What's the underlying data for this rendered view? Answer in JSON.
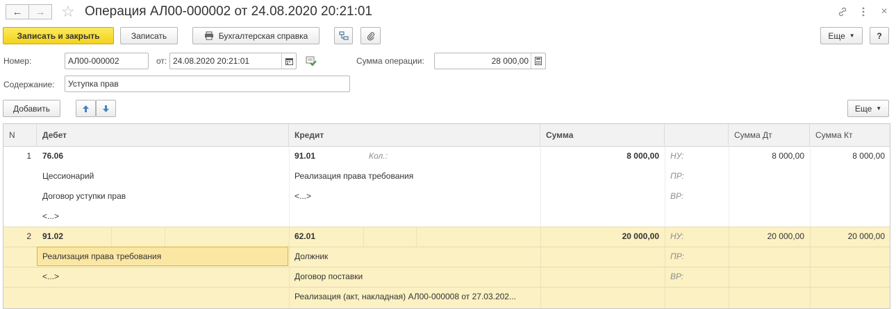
{
  "window": {
    "title": "Операция АЛ00-000002 от 24.08.2020 20:21:01"
  },
  "toolbar": {
    "save_close_label": "Записать и закрыть",
    "save_label": "Записать",
    "report_label": "Бухгалтерская справка",
    "more_label": "Еще",
    "help_label": "?"
  },
  "form": {
    "number_label": "Номер:",
    "number_value": "АЛ00-000002",
    "date_label": "от:",
    "date_value": "24.08.2020 20:21:01",
    "sum_label": "Сумма операции:",
    "sum_value": "28 000,00",
    "content_label": "Содержание:",
    "content_value": "Уступка прав"
  },
  "table_toolbar": {
    "add_label": "Добавить",
    "more_label": "Еще"
  },
  "table": {
    "headers": {
      "n": "N",
      "debit": "Дебет",
      "credit": "Кредит",
      "sum": "Сумма",
      "sum_dt": "Сумма Дт",
      "sum_kt": "Сумма Кт"
    },
    "rows": [
      {
        "n": "1",
        "debit": [
          "76.06",
          "Цессионарий",
          "Договор уступки прав",
          "<...>"
        ],
        "credit": [
          "91.01",
          "Реализация права требования",
          "<...>"
        ],
        "qty_label": "Кол.:",
        "sum": "8 000,00",
        "tax_labels": [
          "НУ:",
          "ПР:",
          "ВР:"
        ],
        "sum_dt": "8 000,00",
        "sum_kt": "8 000,00"
      },
      {
        "n": "2",
        "debit": [
          "91.02",
          "Реализация права требования",
          "<...>"
        ],
        "credit": [
          "62.01",
          "Должник",
          "Договор поставки",
          "Реализация (акт, накладная) АЛ00-000008 от 27.03.202..."
        ],
        "sum": "20 000,00",
        "tax_labels": [
          "НУ:",
          "ПР:",
          "ВР:"
        ],
        "sum_dt": "20 000,00",
        "sum_kt": "20 000,00"
      }
    ]
  },
  "colors": {
    "primary_button": "#f3d31b",
    "selected_row": "#fbf1c3",
    "header_bg": "#f2f2f2"
  }
}
